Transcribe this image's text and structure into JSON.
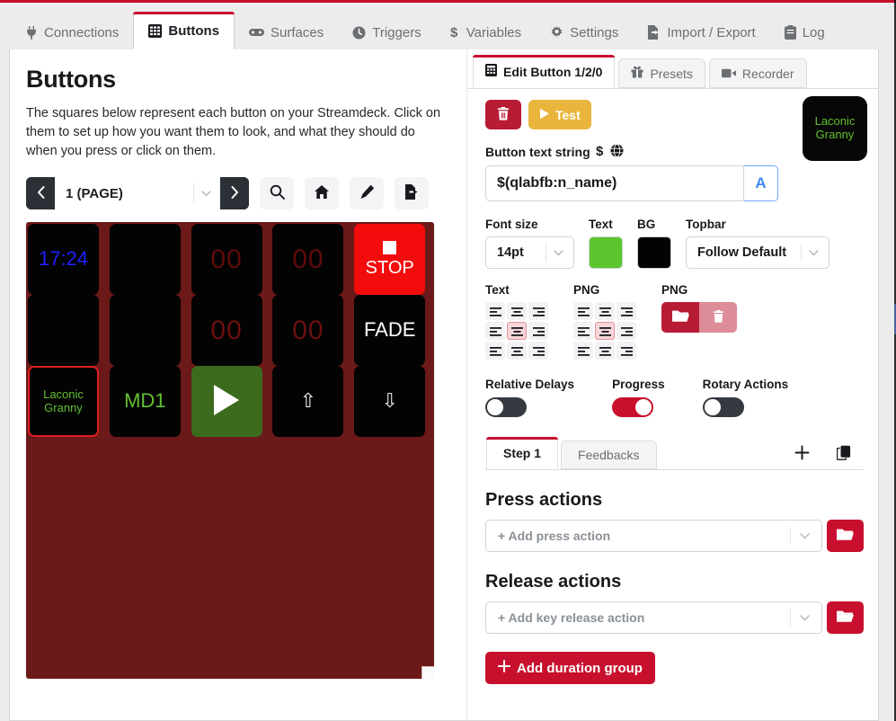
{
  "theme": {
    "accent_red": "#c8102e",
    "dark": "#2b3036",
    "deck_bg": "#6b1919",
    "key_bg": "#030303",
    "key_green_text": "#63c033"
  },
  "main_tabs": [
    {
      "label": "Connections",
      "icon": "plug-icon",
      "active": false
    },
    {
      "label": "Buttons",
      "icon": "grid-icon",
      "active": true
    },
    {
      "label": "Surfaces",
      "icon": "gamepad-icon",
      "active": false
    },
    {
      "label": "Triggers",
      "icon": "clock-icon",
      "active": false
    },
    {
      "label": "Variables",
      "icon": "dollar-icon",
      "active": false
    },
    {
      "label": "Settings",
      "icon": "gear-icon",
      "active": false
    },
    {
      "label": "Import / Export",
      "icon": "file-export-icon",
      "active": false
    },
    {
      "label": "Log",
      "icon": "clipboard-icon",
      "active": false
    }
  ],
  "left": {
    "title": "Buttons",
    "description": "The squares below represent each button on your Streamdeck. Click on them to set up how you want them to look, and what they should do when you press or click on them.",
    "pager": {
      "prev_icon": "chevron-left-icon",
      "next_icon": "chevron-right-icon",
      "page_value": "1 (PAGE)",
      "caret_icon": "chevron-down-icon"
    },
    "toolbar_icons": [
      {
        "name": "search-icon"
      },
      {
        "name": "home-icon"
      },
      {
        "name": "pencil-icon"
      },
      {
        "name": "file-export-icon"
      }
    ],
    "deck": {
      "columns": 5,
      "rows": 3,
      "keys": [
        {
          "text": "17:24",
          "color": "#2020ff",
          "bg": "#030303",
          "size": "mid",
          "selected": false
        },
        {
          "text": "",
          "color": "#ffffff",
          "bg": "#030303",
          "size": "mid",
          "selected": false
        },
        {
          "text": "00",
          "color": "#5e0b0b",
          "bg": "#030303",
          "size": "big",
          "selected": false
        },
        {
          "text": "00",
          "color": "#5e0b0b",
          "bg": "#030303",
          "size": "big",
          "selected": false
        },
        {
          "text": "STOP",
          "color": "#ffffff",
          "bg": "#f20c0c",
          "size": "mid",
          "selected": false,
          "glyph": "stop-square-icon"
        },
        {
          "text": "",
          "color": "#ffffff",
          "bg": "#030303",
          "size": "mid",
          "selected": false
        },
        {
          "text": "",
          "color": "#ffffff",
          "bg": "#030303",
          "size": "mid",
          "selected": false
        },
        {
          "text": "00",
          "color": "#6b0f0f",
          "bg": "#030303",
          "size": "big",
          "selected": false
        },
        {
          "text": "00",
          "color": "#6b0f0f",
          "bg": "#030303",
          "size": "big",
          "selected": false
        },
        {
          "text": "FADE",
          "color": "#ffffff",
          "bg": "#030303",
          "size": "mid",
          "selected": false
        },
        {
          "text": "Laconic Granny",
          "color": "#63c033",
          "bg": "#030303",
          "size": "sm",
          "selected": true
        },
        {
          "text": "MD1",
          "color": "#63c033",
          "bg": "#030303",
          "size": "mid",
          "selected": false
        },
        {
          "text": "",
          "color": "#ffffff",
          "bg": "#3c6b1e",
          "size": "mid",
          "selected": false,
          "glyph": "play-triangle-icon"
        },
        {
          "text": "⇧",
          "color": "#e8e8e8",
          "bg": "#030303",
          "size": "mid",
          "selected": false
        },
        {
          "text": "⇩",
          "color": "#e8e8e8",
          "bg": "#030303",
          "size": "mid",
          "selected": false
        }
      ]
    }
  },
  "right": {
    "tabs": [
      {
        "label": "Edit Button 1/2/0",
        "icon": "keypad-icon",
        "active": true
      },
      {
        "label": "Presets",
        "icon": "gift-icon",
        "active": false
      },
      {
        "label": "Recorder",
        "icon": "video-camera-icon",
        "active": false
      }
    ],
    "actions_bar": {
      "delete_icon": "trash-icon",
      "test_label": "Test",
      "test_icon": "play-icon"
    },
    "preview": {
      "text": "Laconic Granny",
      "text_color": "#63c033",
      "bg_color": "#070707"
    },
    "button_text": {
      "label": "Button text string",
      "dollar_icon": "dollar-icon",
      "globe_icon": "globe-icon",
      "value": "$(qlabfb:n_name)",
      "aa_label": "A",
      "aa_icon": "font-size-icon"
    },
    "style": {
      "font_size_label": "Font size",
      "font_size_value": "14pt",
      "text_label": "Text",
      "text_color": "#5cc62e",
      "bg_label": "BG",
      "bg_color": "#030303",
      "topbar_label": "Topbar",
      "topbar_value": "Follow Default",
      "caret_icon": "chevron-down-icon"
    },
    "alignment": {
      "text_label": "Text",
      "text_selected_index": 4,
      "png_label": "PNG",
      "png_selected_index": 4,
      "png_file_label": "PNG",
      "png_open_icon": "folder-open-icon",
      "png_delete_icon": "trash-icon"
    },
    "toggles": [
      {
        "label": "Relative Delays",
        "on": false
      },
      {
        "label": "Progress",
        "on": true
      },
      {
        "label": "Rotary Actions",
        "on": false
      }
    ],
    "step_tabs": [
      {
        "label": "Step 1",
        "active": true
      },
      {
        "label": "Feedbacks",
        "active": false
      }
    ],
    "step_tools": [
      {
        "name": "add-step-button",
        "icon": "plus-icon"
      },
      {
        "name": "duplicate-step-button",
        "icon": "copy-icon"
      }
    ],
    "press_actions": {
      "title": "Press actions",
      "placeholder": "+ Add press action",
      "caret_icon": "chevron-down-icon",
      "open_icon": "folder-open-icon"
    },
    "release_actions": {
      "title": "Release actions",
      "placeholder": "+ Add key release action",
      "caret_icon": "chevron-down-icon",
      "open_icon": "folder-open-icon"
    },
    "duration_group": {
      "label": "Add duration group",
      "plus_icon": "plus-icon"
    }
  }
}
